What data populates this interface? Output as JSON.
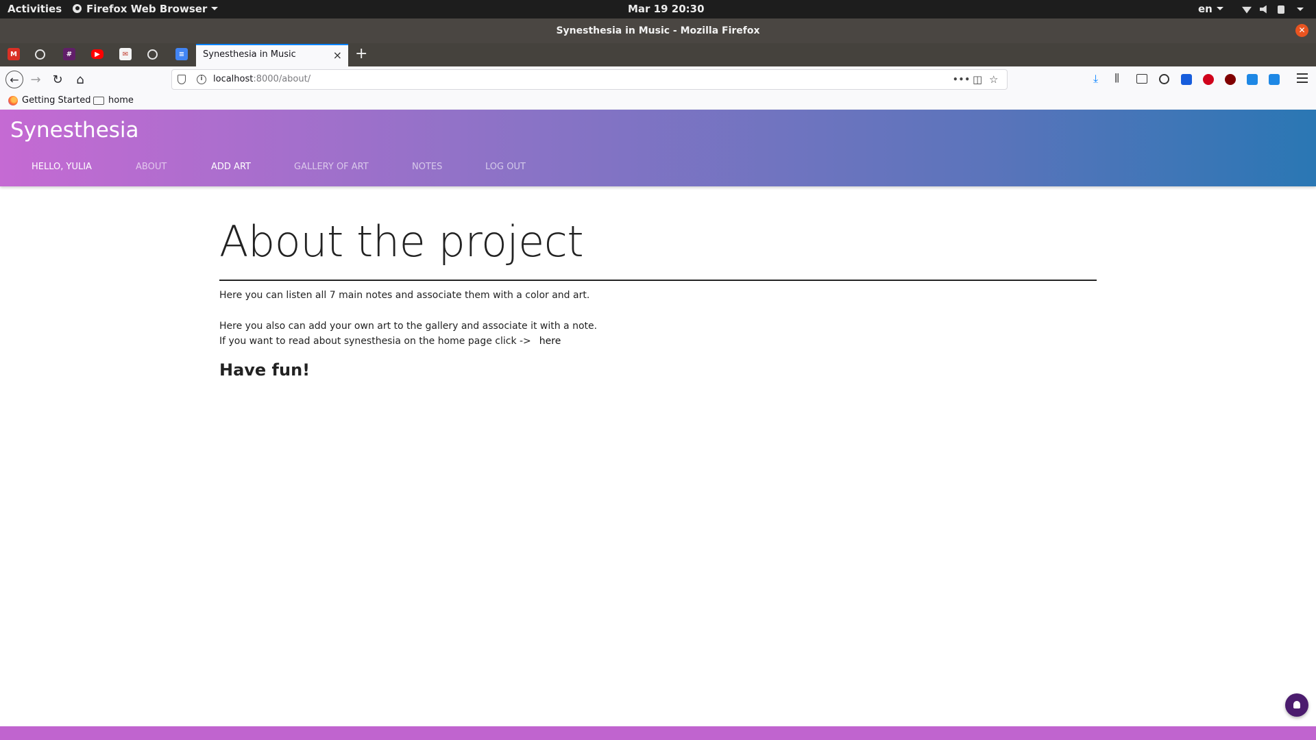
{
  "system_bar": {
    "activities": "Activities",
    "app_name": "Firefox Web Browser",
    "clock": "Mar 19  20:30",
    "language": "en"
  },
  "window": {
    "title": "Synesthesia in Music - Mozilla Firefox"
  },
  "tabs": {
    "pinned_icons": [
      "gmail-icon",
      "github-icon",
      "slack-icon",
      "youtube-icon",
      "notes-icon",
      "github-icon",
      "docs-icon"
    ],
    "active": {
      "title": "Synesthesia in Music",
      "close": "×"
    },
    "new_tab": "+"
  },
  "toolbar": {
    "url_host": "localhost",
    "url_path": ":8000/about/",
    "more": "•••"
  },
  "bookmarks": [
    {
      "label": "Getting Started"
    },
    {
      "label": "home"
    }
  ],
  "site": {
    "brand": "Synesthesia",
    "nav": [
      {
        "label": "Hello, Yulia",
        "state": "bright"
      },
      {
        "label": "About",
        "state": "dim"
      },
      {
        "label": "Add art",
        "state": "bright"
      },
      {
        "label": "Gallery of art",
        "state": "dim"
      },
      {
        "label": "Notes",
        "state": "dim"
      },
      {
        "label": "Log out",
        "state": "dim"
      }
    ]
  },
  "page": {
    "title": "About the project",
    "paragraph_1": "Here you can listen all 7 main notes and associate them with a color and art.",
    "paragraph_2": "Here you also can add your own art to the gallery and associate it with a note.",
    "paragraph_3": "If you want to read about synesthesia on the home page click ->",
    "home_link": "here",
    "closing": "Have fun!"
  },
  "colors": {
    "header_gradient_start": "#c56ad3",
    "header_gradient_end": "#2a77b4",
    "footer_strip": "#c064cf",
    "tab_accent": "#0a84ff"
  }
}
